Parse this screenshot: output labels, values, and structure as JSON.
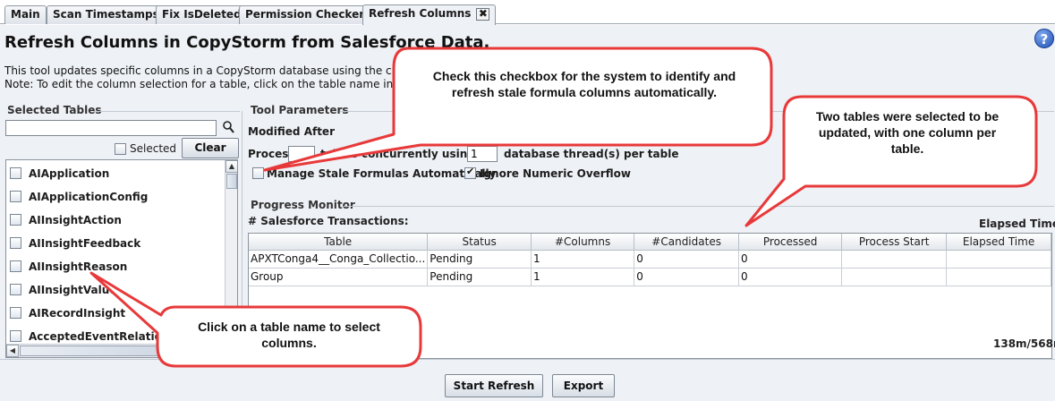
{
  "tabs": [
    {
      "label": "Main"
    },
    {
      "label": "Scan Timestamps"
    },
    {
      "label": "Fix IsDeleted"
    },
    {
      "label": "Permission Checker"
    },
    {
      "label": "Refresh Columns",
      "close": "✖"
    }
  ],
  "page": {
    "title": "Refresh Columns in CopyStorm from Salesforce Data.",
    "help": "?",
    "desc_line1": "This tool updates specific columns in a CopyStorm database using the curren",
    "desc_line2": "Note: To edit the column selection for a table, click on the table name in the li"
  },
  "selected_tables": {
    "group_label": "Selected Tables",
    "search_value": "",
    "selected_label": "Selected",
    "clear_label": "Clear",
    "items": [
      {
        "label": "AIApplication",
        "checked": false
      },
      {
        "label": "AIApplicationConfig",
        "checked": false
      },
      {
        "label": "AIInsightAction",
        "checked": false
      },
      {
        "label": "AIInsightFeedback",
        "checked": false
      },
      {
        "label": "AIInsightReason",
        "checked": false
      },
      {
        "label": "AIInsightValue",
        "checked": false
      },
      {
        "label": "AIRecordInsight",
        "checked": false
      },
      {
        "label": "AcceptedEventRelation",
        "checked": false
      }
    ]
  },
  "tool_parameters": {
    "group_label": "Tool Parameters",
    "modified_after_label": "Modified After",
    "process_label": "Proces",
    "process_value": "",
    "tables_concurrently_label": "tables concurrently using",
    "threads_value": "1",
    "threads_label": "database thread(s) per table",
    "manage_stale_label": "Manage Stale Formulas Automatically",
    "manage_stale_checked": false,
    "ignore_overflow_label": "Ignore Numeric Overflow",
    "ignore_overflow_checked": true
  },
  "progress_monitor": {
    "group_label": "Progress Monitor",
    "transactions_label": "# Salesforce Transactions:",
    "elapsed_label": "Elapsed Time:",
    "memory": "138m/568m",
    "columns": [
      "Table",
      "Status",
      "#Columns",
      "#Candidates",
      "Processed",
      "Process Start",
      "Elapsed Time"
    ],
    "rows": [
      [
        "APXTConga4__Conga_Collectio...",
        "Pending",
        "1",
        "0",
        "0",
        "",
        ""
      ],
      [
        "Group",
        "Pending",
        "1",
        "0",
        "0",
        "",
        ""
      ]
    ]
  },
  "buttons": {
    "start_refresh": "Start Refresh",
    "export": "Export"
  },
  "callouts": {
    "checkbox_note": "Check this checkbox for the system to identify and refresh stale formula columns automatically.",
    "tables_note": "Two tables were selected to be updated, with one column per table.",
    "click_note": "Click on a table name to select columns."
  },
  "colors": {
    "callout_fill": "#ffffff",
    "callout_border": "#e8393a",
    "panel_bg": "#eef1f5"
  }
}
